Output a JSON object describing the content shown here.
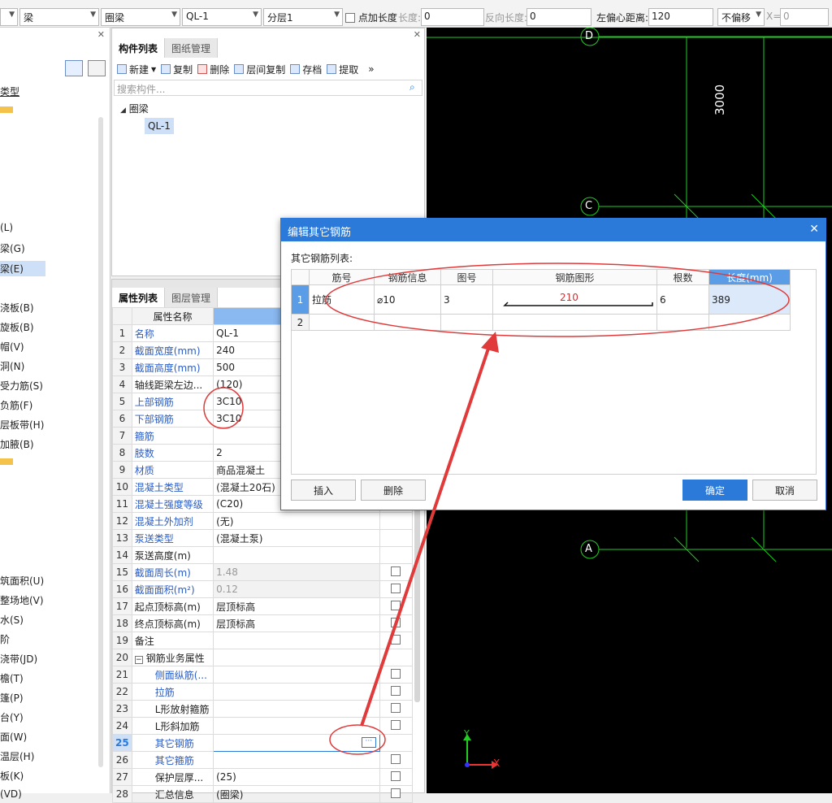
{
  "toolbar": {
    "combo1": "",
    "combo2": "梁",
    "combo3": "圈梁",
    "combo4": "QL-1",
    "combo5": "分层1",
    "point_len_label": "点加长度",
    "len_label": "长度:",
    "len_value": "0",
    "rev_len_label": "反向长度:",
    "rev_len_value": "0",
    "offset_label": "左偏心距离:",
    "offset_value": "120",
    "nooffset": "不偏移",
    "x_label": "X=",
    "x_value": "0"
  },
  "left_items": [
    {
      "t": "类型"
    },
    {
      "t": "(L)"
    },
    {
      "t": "梁(G)"
    },
    {
      "t": "梁(E)"
    },
    {
      "t": "浇板(B)"
    },
    {
      "t": "旋板(B)"
    },
    {
      "t": "帽(V)"
    },
    {
      "t": "洞(N)"
    },
    {
      "t": "受力筋(S)"
    },
    {
      "t": "负筋(F)"
    },
    {
      "t": "层板带(H)"
    },
    {
      "t": "加腋(B)"
    },
    {
      "t": "筑面积(U)"
    },
    {
      "t": "整场地(V)"
    },
    {
      "t": "水(S)"
    },
    {
      "t": "阶"
    },
    {
      "t": "浇带(JD)"
    },
    {
      "t": "檐(T)"
    },
    {
      "t": "篷(P)"
    },
    {
      "t": "台(Y)"
    },
    {
      "t": "面(W)"
    },
    {
      "t": "温层(H)"
    },
    {
      "t": "板(K)"
    },
    {
      "t": "(VD)"
    }
  ],
  "component_panel": {
    "tabs": [
      "构件列表",
      "图纸管理"
    ],
    "buttons": [
      "新建",
      "复制",
      "删除",
      "层间复制",
      "存档",
      "提取"
    ],
    "search_placeholder": "搜索构件...",
    "tree_root": "圈梁",
    "tree_child": "QL-1"
  },
  "property_panel": {
    "tabs": [
      "属性列表",
      "图层管理"
    ],
    "header": "属性名称",
    "rows": [
      {
        "n": "1",
        "name": "名称",
        "val": "QL-1",
        "blue": true
      },
      {
        "n": "2",
        "name": "截面宽度(mm)",
        "val": "240",
        "blue": true
      },
      {
        "n": "3",
        "name": "截面高度(mm)",
        "val": "500",
        "blue": true
      },
      {
        "n": "4",
        "name": "轴线距梁左边...",
        "val": "(120)",
        "blue": false
      },
      {
        "n": "5",
        "name": "上部钢筋",
        "val": "3C10",
        "blue": true
      },
      {
        "n": "6",
        "name": "下部钢筋",
        "val": "3C10",
        "blue": true
      },
      {
        "n": "7",
        "name": "箍筋",
        "val": "",
        "blue": true
      },
      {
        "n": "8",
        "name": "肢数",
        "val": "2",
        "blue": true
      },
      {
        "n": "9",
        "name": "材质",
        "val": "商品混凝土",
        "blue": true
      },
      {
        "n": "10",
        "name": "混凝土类型",
        "val": "(混凝土20石)",
        "blue": true
      },
      {
        "n": "11",
        "name": "混凝土强度等级",
        "val": "(C20)",
        "blue": true
      },
      {
        "n": "12",
        "name": "混凝土外加剂",
        "val": "(无)",
        "blue": true
      },
      {
        "n": "13",
        "name": "泵送类型",
        "val": "(混凝土泵)",
        "blue": true
      },
      {
        "n": "14",
        "name": "泵送高度(m)",
        "val": "",
        "blue": false
      },
      {
        "n": "15",
        "name": "截面周长(m)",
        "val": "1.48",
        "blue": true
      },
      {
        "n": "16",
        "name": "截面面积(m²)",
        "val": "0.12",
        "blue": true
      },
      {
        "n": "17",
        "name": "起点顶标高(m)",
        "val": "层顶标高",
        "blue": false
      },
      {
        "n": "18",
        "name": "终点顶标高(m)",
        "val": "层顶标高",
        "blue": false
      },
      {
        "n": "19",
        "name": "备注",
        "val": "",
        "blue": false
      },
      {
        "n": "20",
        "name": "钢筋业务属性",
        "val": "",
        "blue": false
      },
      {
        "n": "21",
        "name": "侧面纵筋(...",
        "val": "",
        "blue": true
      },
      {
        "n": "22",
        "name": "拉筋",
        "val": "",
        "blue": true
      },
      {
        "n": "23",
        "name": "L形放射箍筋",
        "val": "",
        "blue": false
      },
      {
        "n": "24",
        "name": "L形斜加筋",
        "val": "",
        "blue": false
      },
      {
        "n": "25",
        "name": "其它钢筋",
        "val": "",
        "blue": true
      },
      {
        "n": "26",
        "name": "其它箍筋",
        "val": "",
        "blue": true
      },
      {
        "n": "27",
        "name": "保护层厚...",
        "val": "(25)",
        "blue": false
      },
      {
        "n": "28",
        "name": "汇总信息",
        "val": "(圈梁)",
        "blue": false
      }
    ]
  },
  "cad": {
    "axis_labels": [
      "D",
      "C",
      "A"
    ],
    "dim_text": "3000",
    "axis_x": "X",
    "axis_y": "Y"
  },
  "dialog": {
    "title": "编辑其它钢筋",
    "subtitle": "其它钢筋列表:",
    "columns": [
      "筋号",
      "钢筋信息",
      "图号",
      "钢筋图形",
      "根数",
      "长度(mm)"
    ],
    "rows": [
      {
        "idx": "1",
        "name": "拉筋",
        "info": "10",
        "fig": "3",
        "shape": "210",
        "count": "6",
        "length": "389"
      },
      {
        "idx": "2",
        "name": "",
        "info": "",
        "fig": "",
        "shape": "",
        "count": "",
        "length": ""
      }
    ],
    "buttons": {
      "insert": "插入",
      "delete": "删除",
      "ok": "确定",
      "cancel": "取消"
    }
  },
  "colors": {
    "accent": "#2b79d8",
    "annotation": "#e03a3a",
    "cad_grid": "#22cc22"
  }
}
